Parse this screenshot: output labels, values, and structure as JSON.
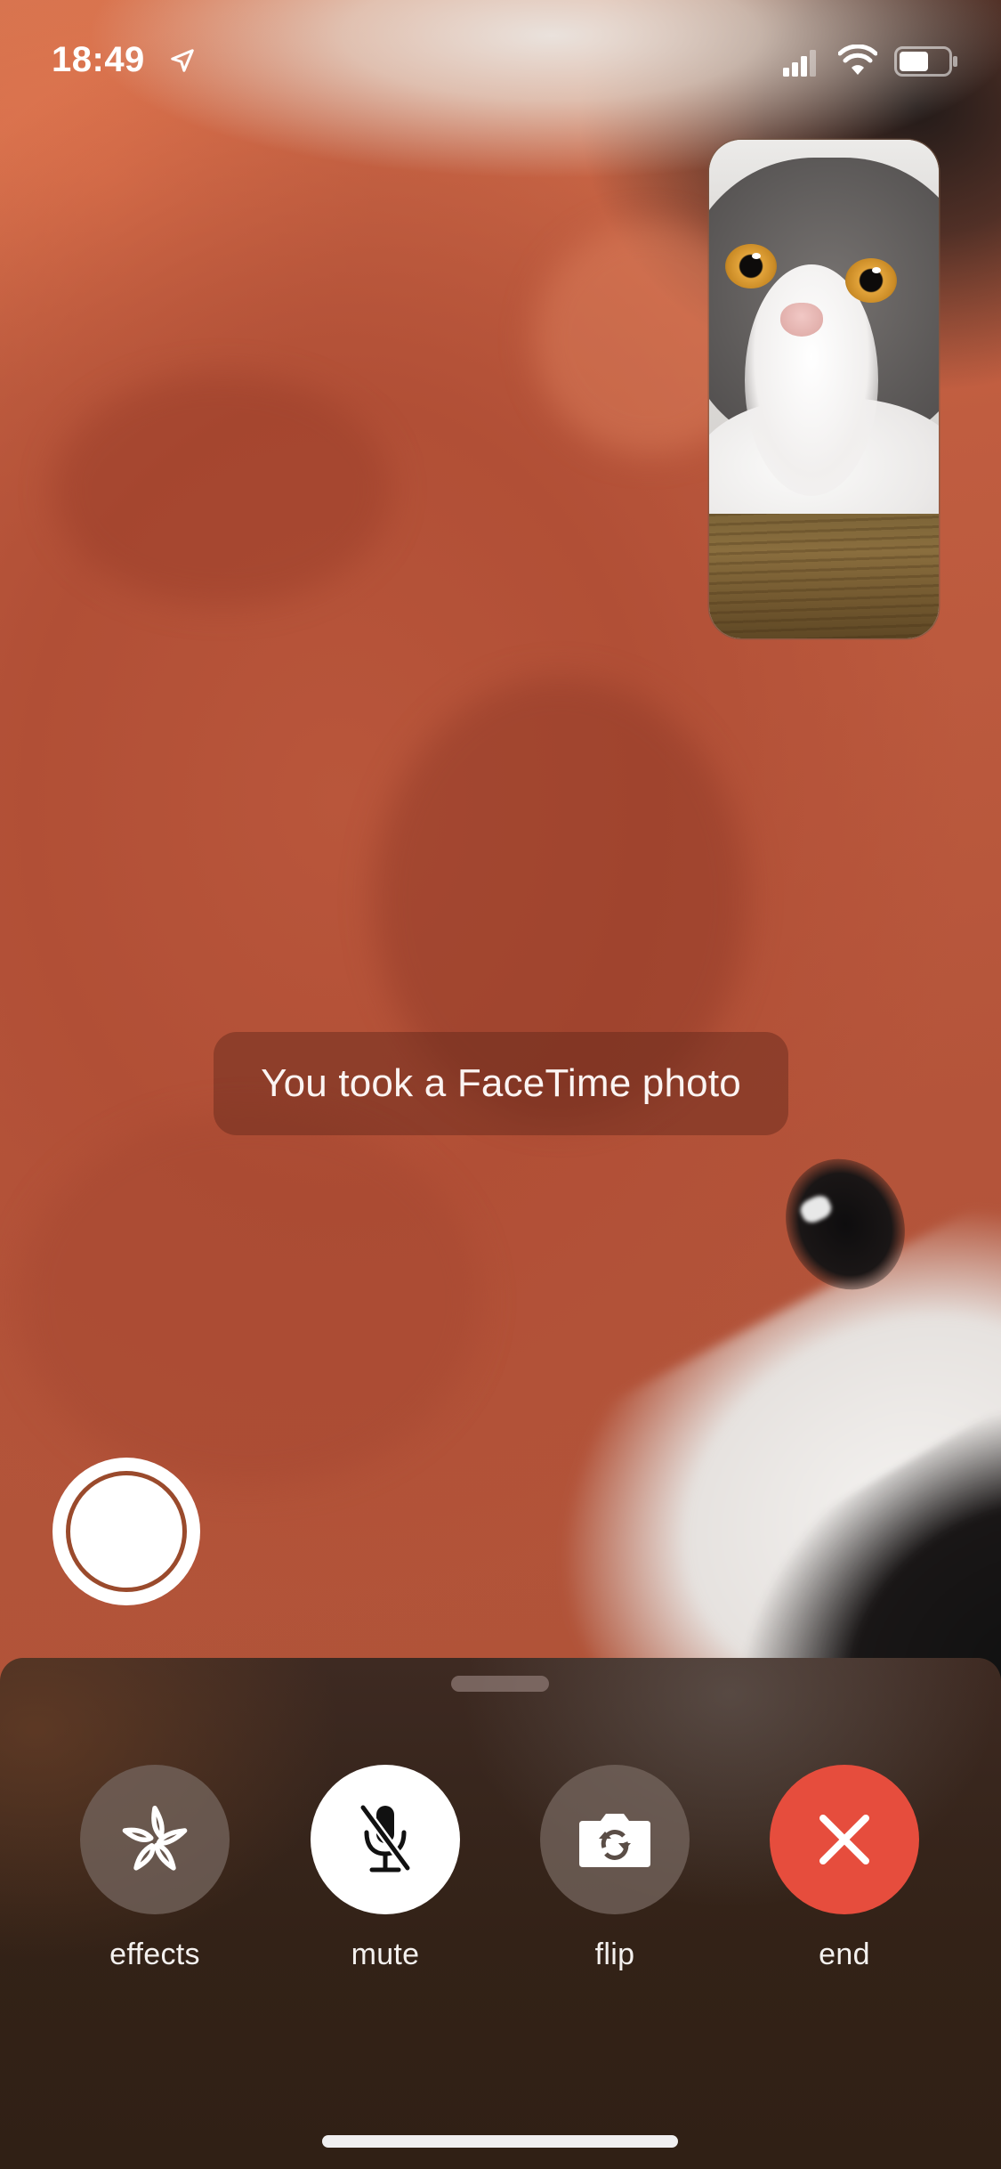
{
  "status_bar": {
    "time": "18:49",
    "icons": [
      "location-arrow-icon",
      "cellular-signal-icon",
      "wifi-icon",
      "battery-icon"
    ]
  },
  "remote_video": {
    "description": "Close-up of orange and white plush fur"
  },
  "self_view": {
    "description": "Gray and white Scottish Fold cat on wooden table"
  },
  "toast": {
    "message": "You took a FaceTime photo"
  },
  "shutter": {
    "label": "Take FaceTime photo",
    "icon": "shutter-icon"
  },
  "controls": {
    "effects": {
      "label": "effects",
      "icon": "effects-star-icon"
    },
    "mute": {
      "label": "mute",
      "icon": "microphone-slash-icon",
      "active": true
    },
    "flip": {
      "label": "flip",
      "icon": "camera-flip-icon"
    },
    "end": {
      "label": "end",
      "icon": "close-x-icon"
    }
  },
  "colors": {
    "end_red": "#e64d3d",
    "panel_bg": "#332217",
    "control_gray": "#73645c",
    "text_white": "#ffffff"
  }
}
